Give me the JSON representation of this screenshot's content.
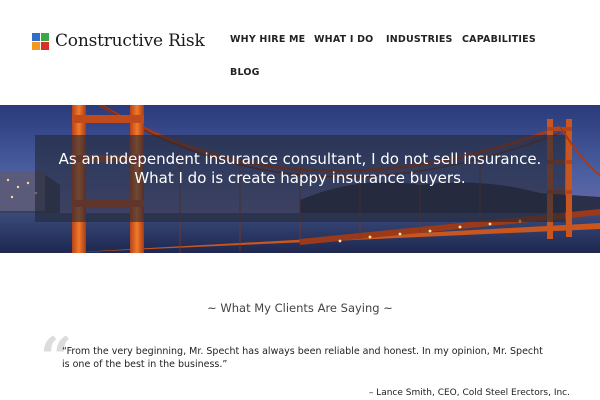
{
  "brand": {
    "name": "Constructive Risk",
    "colors": {
      "blue": "#2f6fc9",
      "green": "#3aa845",
      "orange": "#f39a1e",
      "red": "#d9302c"
    }
  },
  "nav": {
    "items": [
      {
        "label": "WHY HIRE ME"
      },
      {
        "label": "WHAT I DO"
      },
      {
        "label": "INDUSTRIES"
      },
      {
        "label": "CAPABILITIES"
      },
      {
        "label": "BLOG"
      }
    ]
  },
  "hero": {
    "line1": "As an independent insurance consultant, I do not sell insurance.",
    "line2": "What I do is create happy insurance buyers."
  },
  "testimonials": {
    "title": "~ What My Clients Are Saying ~",
    "quote_icon": "left-quote-icon",
    "quote": "“From the very beginning, Mr. Specht has always been reliable and honest. In my opinion, Mr. Specht is one of the best in the business.”",
    "author": "– Lance Smith, CEO, Cold Steel Erectors, Inc."
  }
}
